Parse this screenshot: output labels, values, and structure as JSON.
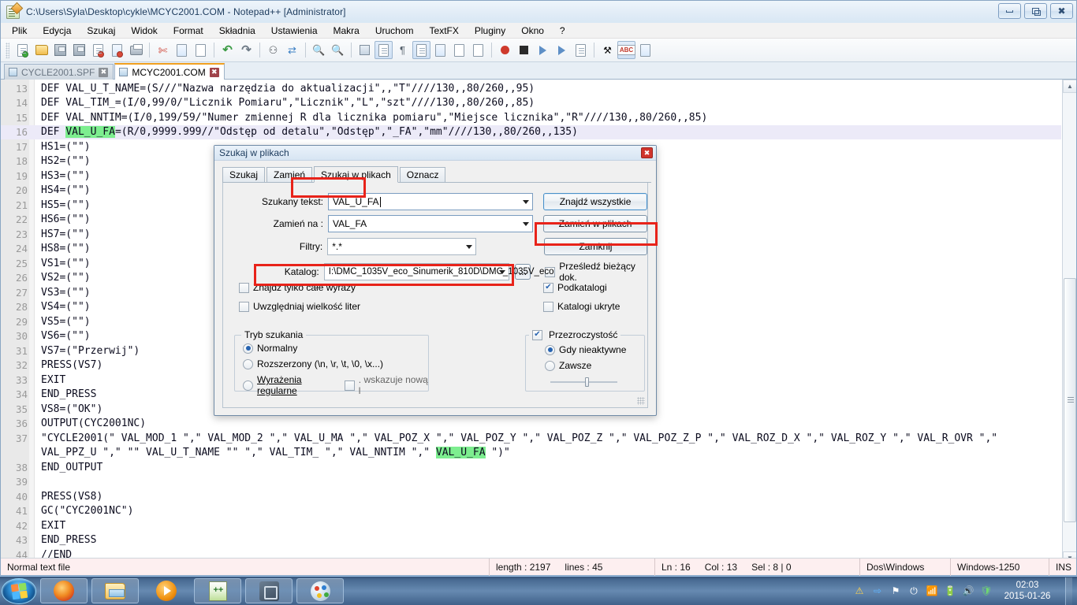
{
  "window": {
    "title": "C:\\Users\\Syla\\Desktop\\cykle\\MCYC2001.COM - Notepad++ [Administrator]",
    "icon": "notepad-plus-plus-icon",
    "minimize": "minimize-icon",
    "maximize": "restore-icon",
    "close": "close-icon"
  },
  "menu": {
    "items": [
      "Plik",
      "Edycja",
      "Szukaj",
      "Widok",
      "Format",
      "Składnia",
      "Ustawienia",
      "Makra",
      "Uruchom",
      "TextFX",
      "Pluginy",
      "Okno",
      "?"
    ]
  },
  "tabs": [
    {
      "label": "CYCLE2001.SPF",
      "active": false
    },
    {
      "label": "MCYC2001.COM",
      "active": true
    }
  ],
  "editor": {
    "lines": [
      {
        "num": "13",
        "text": "DEF VAL_U_T_NAME=(S///\"Nazwa narzędzia do aktualizacji\",,\"T\"////130,,80/260,,95)"
      },
      {
        "num": "14",
        "text": "DEF VAL_TIM_=(I/0,99/0/\"Licznik Pomiaru\",\"Licznik\",\"L\",\"szt\"////130,,80/260,,85)"
      },
      {
        "num": "15",
        "text": "DEF VAL_NNTIM=(I/0,199/59/\"Numer zmiennej R dla licznika pomiaru\",\"Miejsce licznika\",\"R\"////130,,80/260,,85)"
      },
      {
        "num": "16",
        "text": "DEF VAL_U_FA=(R/0,9999.999//\"Odstęp od detalu\",\"Odstęp\",\"_FA\",\"mm\"////130,,80/260,,135)"
      },
      {
        "num": "17",
        "text": "HS1=(\"\")"
      },
      {
        "num": "18",
        "text": "HS2=(\"\")"
      },
      {
        "num": "19",
        "text": "HS3=(\"\")"
      },
      {
        "num": "20",
        "text": "HS4=(\"\")"
      },
      {
        "num": "21",
        "text": "HS5=(\"\")"
      },
      {
        "num": "22",
        "text": "HS6=(\"\")"
      },
      {
        "num": "23",
        "text": "HS7=(\"\")"
      },
      {
        "num": "24",
        "text": "HS8=(\"\")"
      },
      {
        "num": "25",
        "text": "VS1=(\"\")"
      },
      {
        "num": "26",
        "text": "VS2=(\"\")"
      },
      {
        "num": "27",
        "text": "VS3=(\"\")"
      },
      {
        "num": "28",
        "text": "VS4=(\"\")"
      },
      {
        "num": "29",
        "text": "VS5=(\"\")"
      },
      {
        "num": "30",
        "text": "VS6=(\"\")"
      },
      {
        "num": "31",
        "text": "VS7=(\"Przerwij\")"
      },
      {
        "num": "32",
        "text": "PRESS(VS7)"
      },
      {
        "num": "33",
        "text": "EXIT"
      },
      {
        "num": "34",
        "text": "END_PRESS"
      },
      {
        "num": "35",
        "text": "VS8=(\"OK\")"
      },
      {
        "num": "36",
        "text": "OUTPUT(CYC2001NC)"
      },
      {
        "num": "37",
        "text": "\"CYCLE2001(\" VAL_MOD_1 \",\" VAL_MOD_2 \",\" VAL_U_MA \",\" VAL_POZ_X \",\" VAL_POZ_Y \",\" VAL_POZ_Z \",\" VAL_POZ_Z_P \",\" VAL_ROZ_D_X \",\" VAL_ROZ_Y \",\" VAL_R_OVR \",\""
      },
      {
        "num": "",
        "text": "VAL_PPZ_U \",\" \"\" VAL_U_T_NAME \"\" \",\" VAL_TIM_ \",\" VAL_NNTIM \",\" VAL_U_FA \")\""
      },
      {
        "num": "38",
        "text": "END_OUTPUT"
      },
      {
        "num": "39",
        "text": ""
      },
      {
        "num": "40",
        "text": "PRESS(VS8)"
      },
      {
        "num": "41",
        "text": "GC(\"CYC2001NC\")"
      },
      {
        "num": "42",
        "text": "EXIT"
      },
      {
        "num": "43",
        "text": "END_PRESS"
      },
      {
        "num": "44",
        "text": "//END"
      },
      {
        "num": "45",
        "text": ""
      }
    ],
    "line16_parts": {
      "pre": "DEF ",
      "highlight": "VAL_U_FA",
      "post": "=(R/0,9999.999//\"Odstęp od detalu\",\"Odstęp\",\"_FA\",\"mm\"////130,,80/260,,135)"
    },
    "line37b_parts": {
      "pre": "VAL_PPZ_U \",\" \"\" VAL_U_T_NAME \"\" \",\" VAL_TIM_ \",\" VAL_NNTIM \",\" ",
      "highlight": "VAL_U_FA",
      "post": " \")\""
    },
    "highlight_color": "#7dee8f",
    "current_line_color": "#eceaf8"
  },
  "dialog": {
    "title": "Szukaj w plikach",
    "close_label": "✖",
    "tabs": [
      {
        "label": "Szukaj",
        "active": false
      },
      {
        "label": "Zamień",
        "active": false
      },
      {
        "label": "Szukaj w plikach",
        "active": true
      },
      {
        "label": "Oznacz",
        "active": false
      }
    ],
    "fields": {
      "find_label": "Szukany tekst:",
      "find_value": "VAL_U_FA",
      "replace_label": "Zamień na :",
      "replace_value": "VAL_FA",
      "filters_label": "Filtry:",
      "filters_value": "*.*",
      "dir_label": "Katalog:",
      "dir_value": "I:\\DMC_1035V_eco_Sinumerik_810D\\DMC_1035V_eco",
      "browse_label": "..."
    },
    "buttons": {
      "find_all": "Znajdź wszystkie",
      "replace_in_files": "Zamień w plikach",
      "close": "Zamknij"
    },
    "checkboxes_left": [
      {
        "label": "Znajdź tylko całe wyrazy",
        "checked": false
      },
      {
        "label": "Uwzględniaj wielkość liter",
        "checked": false
      }
    ],
    "checkboxes_right": [
      {
        "label": "Prześledź bieżący dok.",
        "checked": false
      },
      {
        "label": "Podkatalogi",
        "checked": true
      },
      {
        "label": "Katalogi ukryte",
        "checked": false
      }
    ],
    "search_mode": {
      "title": "Tryb szukania",
      "options": [
        {
          "label": "Normalny",
          "selected": true
        },
        {
          "label": "Rozszerzony (\\n, \\r, \\t, \\0, \\x...)",
          "selected": false
        },
        {
          "label": "Wyrażenia regularne",
          "selected": false
        }
      ],
      "newline_checkbox": {
        "label": ". wskazuje nową l",
        "checked": false
      }
    },
    "transparency": {
      "title": "Przezroczystość",
      "enabled": true,
      "options": [
        {
          "label": "Gdy nieaktywne",
          "selected": true
        },
        {
          "label": "Zawsze",
          "selected": false
        }
      ],
      "slider_pct": 52
    },
    "highlight_color": "#e8231a"
  },
  "statusbar": {
    "file_type": "Normal text file",
    "length": "length : 2197",
    "lines": "lines : 45",
    "ln": "Ln : 16",
    "col": "Col : 13",
    "sel": "Sel : 8 | 0",
    "eol": "Dos\\Windows",
    "encoding": "Windows-1250",
    "insert_mode": "INS"
  },
  "taskbar": {
    "start": "windows-start-orb-icon",
    "items": [
      {
        "icon": "firefox-icon",
        "pinned": true
      },
      {
        "icon": "folder-explorer-icon",
        "pinned": true
      },
      {
        "icon": "media-player-icon",
        "pinned": true
      },
      {
        "icon": "notepad-plus-plus-icon",
        "running": true
      },
      {
        "icon": "virtualbox-icon",
        "running": true
      },
      {
        "icon": "paint-icon",
        "running": true
      }
    ],
    "tray": [
      "warning-triangle-icon",
      "sync-arrow-icon",
      "flag-error-icon",
      "power-plug-icon",
      "network-signal-icon",
      "battery-error-icon",
      "volume-icon",
      "shield-ok-icon"
    ],
    "clock_time": "02:03",
    "clock_date": "2015-01-26"
  }
}
